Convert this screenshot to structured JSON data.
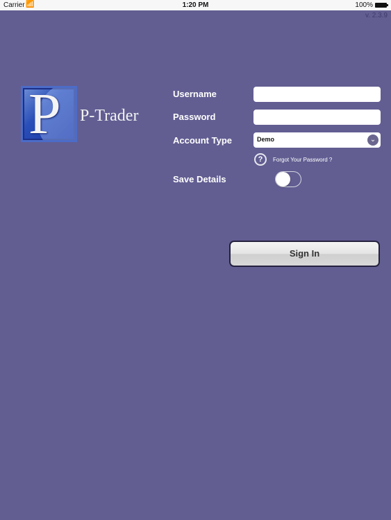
{
  "status_bar": {
    "carrier": "Carrier",
    "wifi_icon": "wifi-icon",
    "time": "1:20 PM",
    "battery_percent": "100%",
    "battery_icon": "battery-icon"
  },
  "version": "v. 2.3.9",
  "logo": {
    "letter": "P",
    "text": "P-Trader"
  },
  "form": {
    "username_label": "Username",
    "username_value": "",
    "password_label": "Password",
    "password_value": "",
    "account_type_label": "Account Type",
    "account_type_value": "Demo",
    "dropdown_icon": "chevron-down-icon",
    "help_icon_glyph": "?",
    "forgot_password": "Forgot Your Password ?",
    "save_details_label": "Save Details",
    "save_details_on": false,
    "sign_in": "Sign In"
  },
  "colors": {
    "background": "#625e92",
    "button_border": "#24213f"
  }
}
